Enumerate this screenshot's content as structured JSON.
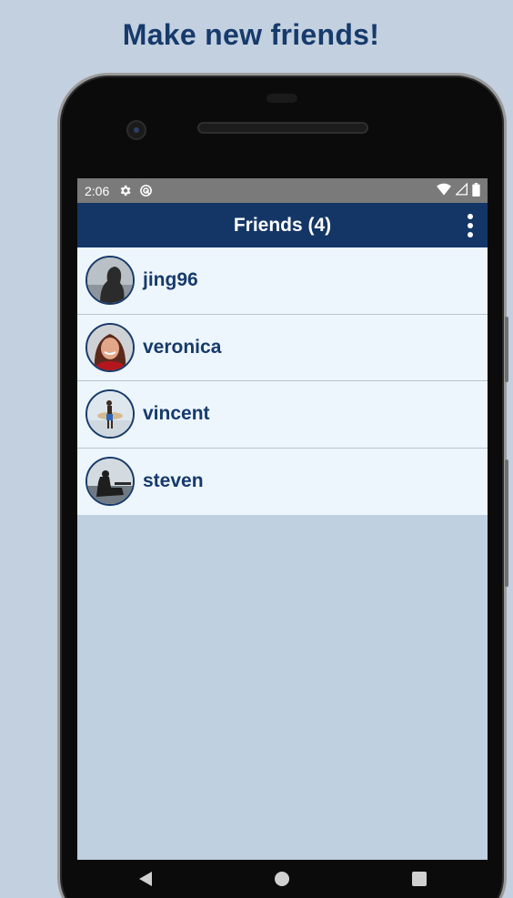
{
  "headline": "Make new friends!",
  "status_bar": {
    "time": "2:06",
    "icons": [
      "settings-icon",
      "sync-icon",
      "wifi-icon",
      "signal-icon",
      "battery-icon"
    ]
  },
  "app_bar": {
    "title": "Friends (4)",
    "menu_icon": "more-vert-icon"
  },
  "friends": [
    {
      "username": "jing96"
    },
    {
      "username": "veronica"
    },
    {
      "username": "vincent"
    },
    {
      "username": "steven"
    }
  ],
  "nav_bar": [
    "back-icon",
    "home-icon",
    "recents-icon"
  ],
  "colors": {
    "background": "#c3d0df",
    "primary": "#143666",
    "list_background": "#edf6fd",
    "statusbar": "#7a7a7a"
  }
}
